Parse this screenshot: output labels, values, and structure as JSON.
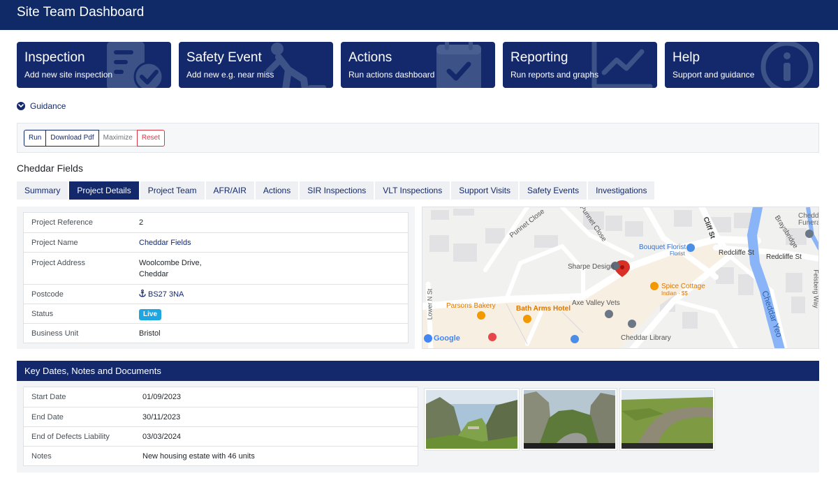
{
  "app": {
    "title": "Site Team Dashboard"
  },
  "tiles": [
    {
      "title": "Inspection",
      "subtitle": "Add new site inspection",
      "icon": "clipboard-check-icon"
    },
    {
      "title": "Safety Event",
      "subtitle": "Add new e.g. near miss",
      "icon": "person-falling-icon"
    },
    {
      "title": "Actions",
      "subtitle": "Run actions dashboard",
      "icon": "calendar-check-icon"
    },
    {
      "title": "Reporting",
      "subtitle": "Run reports and graphs",
      "icon": "line-chart-icon"
    },
    {
      "title": "Help",
      "subtitle": "Support and guidance",
      "icon": "info-circle-icon"
    }
  ],
  "guidance": {
    "label": "Guidance"
  },
  "toolbar": {
    "run": "Run",
    "download": "Download Pdf",
    "maximize": "Maximize",
    "reset": "Reset"
  },
  "project": {
    "title": "Cheddar Fields"
  },
  "tabs": [
    "Summary",
    "Project Details",
    "Project Team",
    "AFR/AIR",
    "Actions",
    "SIR Inspections",
    "VLT Inspections",
    "Support Visits",
    "Safety Events",
    "Investigations"
  ],
  "active_tab": "Project Details",
  "details": {
    "reference_label": "Project Reference",
    "reference": "2",
    "name_label": "Project Name",
    "name": "Cheddar Fields",
    "address_label": "Project Address",
    "address_line1": "Woolcombe Drive,",
    "address_line2": "Cheddar",
    "postcode_label": "Postcode",
    "postcode": "BS27 3NA",
    "status_label": "Status",
    "status": "Live",
    "unit_label": "Business Unit",
    "unit": "Bristol"
  },
  "map": {
    "labels": {
      "punnet_close_1": "Punnet Close",
      "punnet_close_2": "Punnet Close",
      "cliff_st": "Cliff St",
      "cheddar_funeral": "Chedd Funera",
      "braysbridge": "Braysbridge",
      "bouquet_florist": "Bouquet Florist",
      "florist": "Florist",
      "redcliffe_st_1": "Redcliffe St",
      "redcliffe_st_2": "Redcliffe St",
      "sharpe_design": "Sharpe Design",
      "spice_cottage": "Spice Cottage",
      "indian": "Indian · $$",
      "felsberg_way": "Felsberg Way",
      "parsons_bakery": "Parsons Bakery",
      "bath_arms_hotel": "Bath Arms Hotel",
      "axe_valley_vets": "Axe Valley Vets",
      "cheddar_yeo": "Cheddar Yeo",
      "lower_n_st": "Lower N St",
      "cheddar_library": "Cheddar Library",
      "google": "Google"
    }
  },
  "dates": {
    "title": "Key Dates, Notes and Documents",
    "start_label": "Start Date",
    "start": "01/09/2023",
    "end_label": "End Date",
    "end": "30/11/2023",
    "defects_label": "End of Defects Liability",
    "defects": "03/03/2024",
    "notes_label": "Notes",
    "notes": "New housing estate with 46 units"
  },
  "colors": {
    "navy": "#13296b",
    "header": "#0f2a66",
    "live": "#1ea6e0",
    "reset": "#dc3545"
  }
}
